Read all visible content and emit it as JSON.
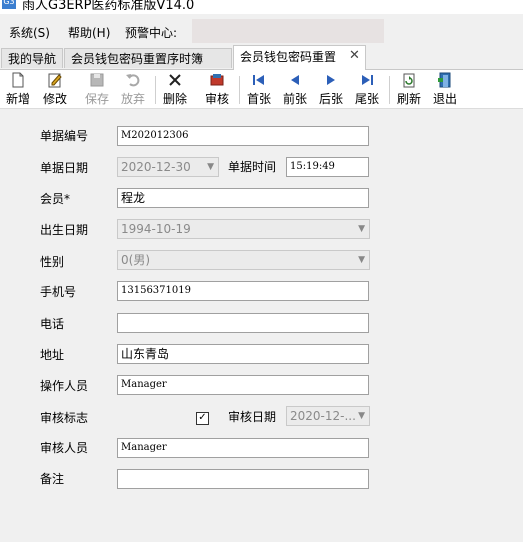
{
  "window": {
    "title": "雨人G3ERP医药标准版V14.0",
    "icon": "app-icon"
  },
  "menu": {
    "items": [
      "系统(S)",
      "帮助(H)",
      "预警中心:"
    ]
  },
  "tabs": [
    {
      "label": "我的导航"
    },
    {
      "label": "会员钱包密码重置序时簿"
    },
    {
      "label": "会员钱包密码重置"
    }
  ],
  "toolbar": {
    "buttons": [
      {
        "label": "新增",
        "icon": "new-doc-icon",
        "enabled": true
      },
      {
        "label": "修改",
        "icon": "edit-icon",
        "enabled": true
      },
      {
        "label": "保存",
        "icon": "save-icon",
        "enabled": false
      },
      {
        "label": "放弃",
        "icon": "undo-icon",
        "enabled": false
      },
      {
        "label": "删除",
        "icon": "delete-x-icon",
        "enabled": true
      },
      {
        "label": "审核",
        "icon": "approve-icon",
        "enabled": true
      },
      {
        "label": "首张",
        "icon": "first-icon",
        "enabled": true
      },
      {
        "label": "前张",
        "icon": "prev-icon",
        "enabled": true
      },
      {
        "label": "后张",
        "icon": "next-icon",
        "enabled": true
      },
      {
        "label": "尾张",
        "icon": "last-icon",
        "enabled": true
      },
      {
        "label": "刷新",
        "icon": "refresh-icon",
        "enabled": true
      },
      {
        "label": "退出",
        "icon": "exit-icon",
        "enabled": true
      }
    ]
  },
  "form": {
    "doc_no": {
      "label": "单据编号",
      "value": "M202012306"
    },
    "doc_date": {
      "label": "单据日期",
      "value": "2020-12-30"
    },
    "doc_time": {
      "label": "单据时间",
      "value": "15:19:49"
    },
    "member": {
      "label": "会员*",
      "value": "程龙"
    },
    "birth_date": {
      "label": "出生日期",
      "value": "1994-10-19"
    },
    "gender": {
      "label": "性别",
      "value": "0(男)"
    },
    "mobile": {
      "label": "手机号",
      "value": "13156371019"
    },
    "phone": {
      "label": "电话",
      "value": ""
    },
    "address": {
      "label": "地址",
      "value": "山东青岛"
    },
    "operator": {
      "label": "操作人员",
      "value": "Manager"
    },
    "audit_flag": {
      "label": "审核标志",
      "checked": true
    },
    "audit_date": {
      "label": "审核日期",
      "value": "2020-12-..."
    },
    "auditor": {
      "label": "审核人员",
      "value": "Manager"
    },
    "remark": {
      "label": "备注",
      "value": ""
    }
  }
}
